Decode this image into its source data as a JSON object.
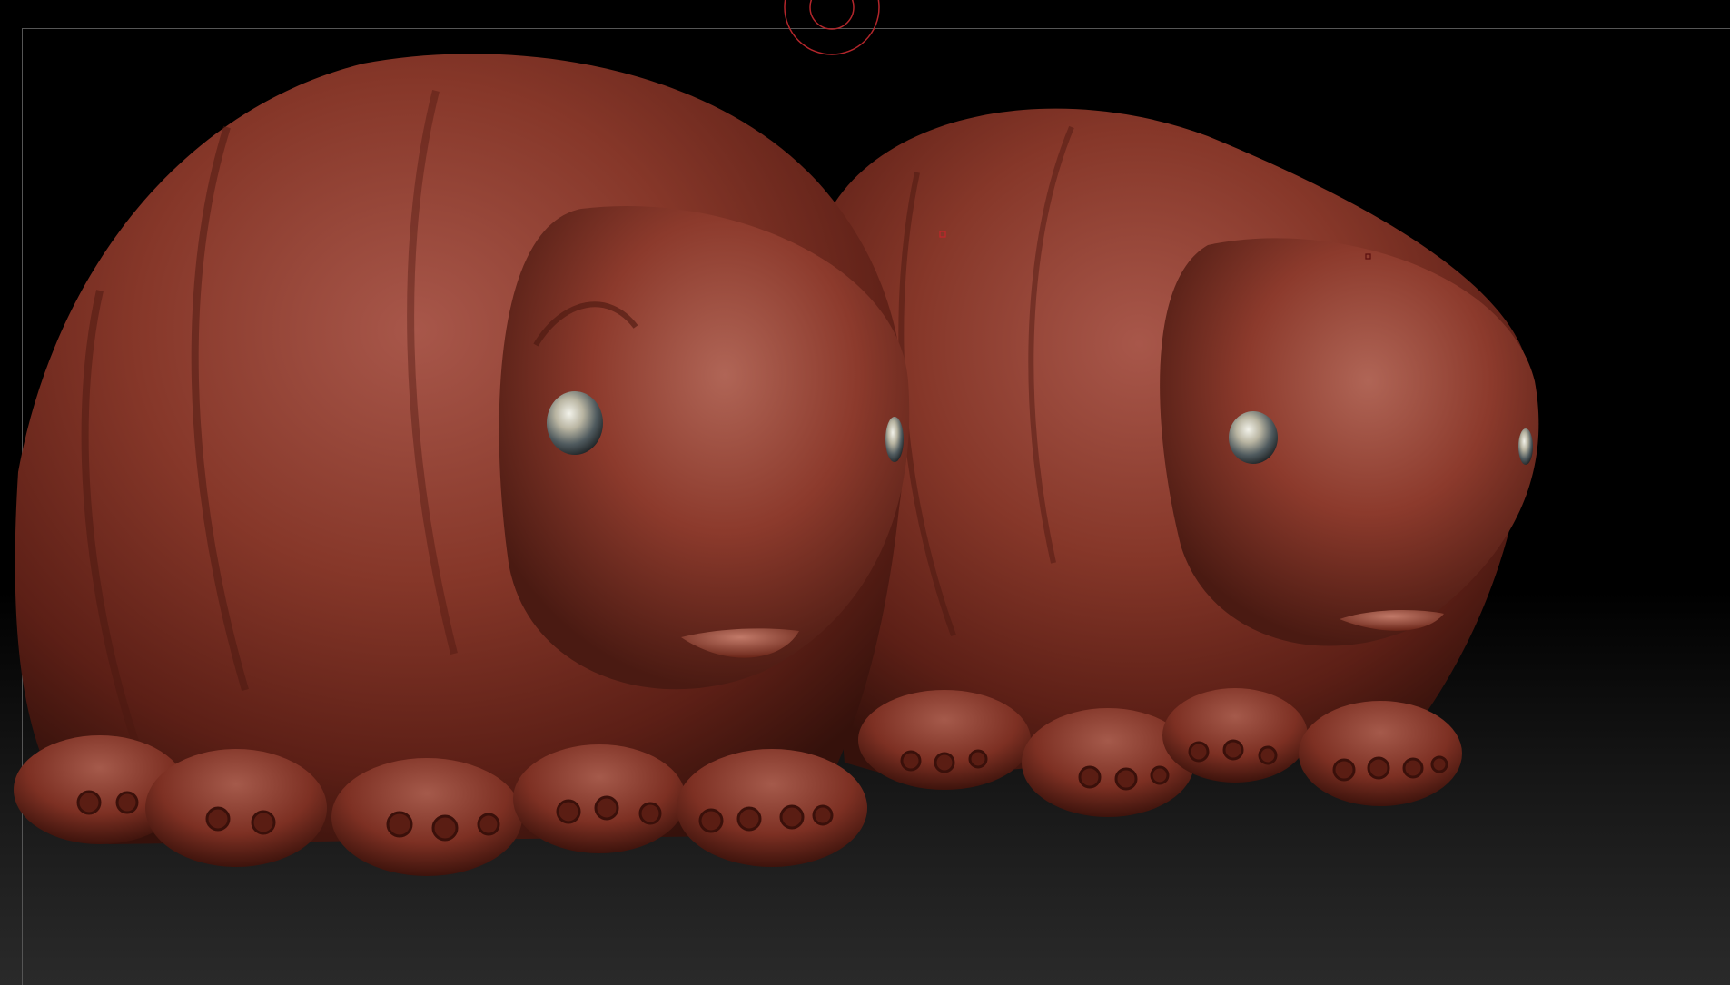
{
  "app": {
    "name": "",
    "viewport_label": ""
  },
  "colors": {
    "background_top": "#000000",
    "background_bottom": "#2a2a2a",
    "model_base": "#7a2e22",
    "model_highlight": "#a85a4a",
    "model_shadow": "#3a120c",
    "brush_cursor": "#b3262b",
    "eye": "#9a9a8a"
  },
  "icons": {
    "brush_cursor": "brush-cursor-icon",
    "marker": "marker-icon"
  }
}
